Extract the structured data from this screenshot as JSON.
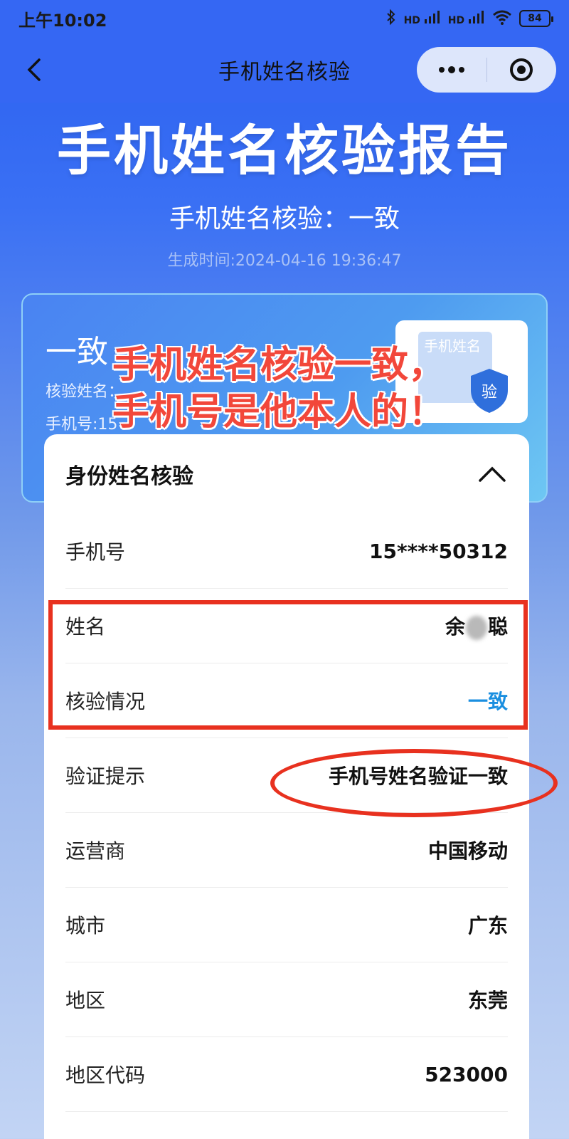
{
  "status_bar": {
    "time": "上午10:02",
    "signal_1": "HD",
    "signal_2": "HD",
    "battery": "84"
  },
  "nav": {
    "title": "手机姓名核验"
  },
  "hero": {
    "title": "手机姓名核验报告",
    "subtitle": "手机姓名核验：一致",
    "generated_time": "生成时间:2024-04-16 19:36:47"
  },
  "summary": {
    "result": "一致",
    "name_line": "核验姓名：",
    "phone_line": "手机号:15",
    "badge_text_1": "手机姓名",
    "badge_text_2": "验"
  },
  "annotation": {
    "line1": "手机姓名核验一致，",
    "line2": "手机号是他本人的！"
  },
  "detail": {
    "header": "身份姓名核验",
    "rows": [
      {
        "label": "手机号",
        "value": "15****50312"
      },
      {
        "label": "姓名",
        "value_prefix": "余",
        "value_suffix": "聪"
      },
      {
        "label": "核验情况",
        "value": "一致"
      },
      {
        "label": "验证提示",
        "value": "手机号姓名验证一致"
      },
      {
        "label": "运营商",
        "value": "中国移动"
      },
      {
        "label": "城市",
        "value": "广东"
      },
      {
        "label": "地区",
        "value": "东莞"
      },
      {
        "label": "地区代码",
        "value": "523000"
      }
    ]
  },
  "colors": {
    "nav_bg": "#3567f3",
    "accent_ok": "#1b8fe0",
    "markup_red": "#e8311f"
  }
}
